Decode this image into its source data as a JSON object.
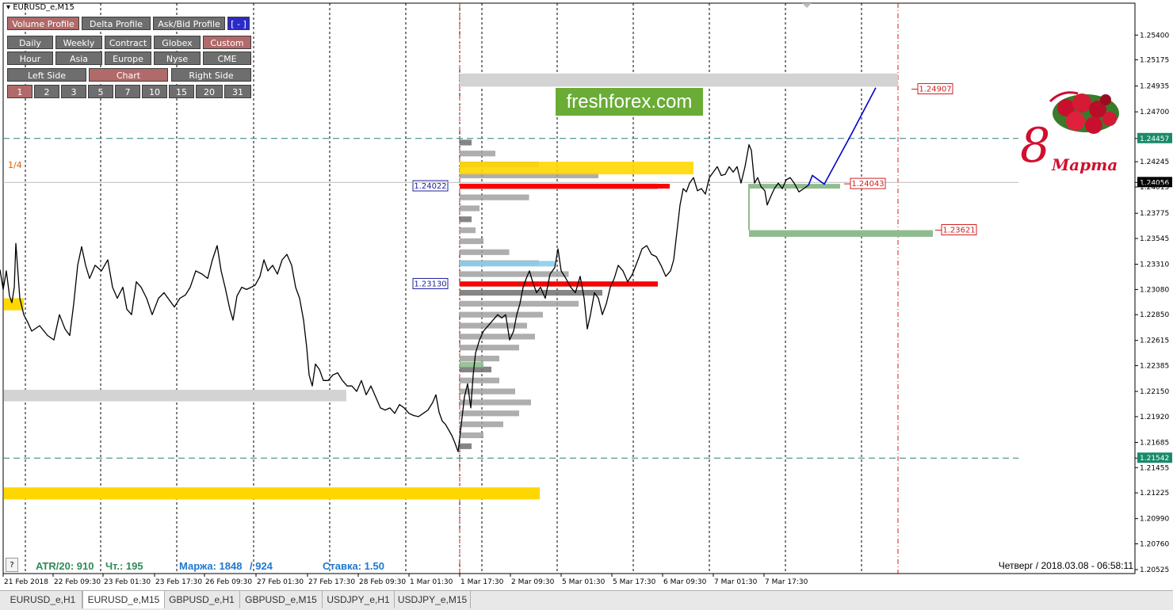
{
  "window": {
    "title": "EURUSD_e,M15"
  },
  "toolbar": {
    "row1": [
      {
        "label": "Volume Profile",
        "active": true
      },
      {
        "label": "Delta Profile",
        "active": false
      },
      {
        "label": "Ask/Bid Profile",
        "active": false
      },
      {
        "label": "[ - ]",
        "active": false
      }
    ],
    "row2": [
      {
        "label": "Daily",
        "active": false
      },
      {
        "label": "Weekly",
        "active": false
      },
      {
        "label": "Contract",
        "active": false
      },
      {
        "label": "Globex",
        "active": false
      },
      {
        "label": "Custom",
        "active": true
      }
    ],
    "row3": [
      {
        "label": "Hour",
        "active": false
      },
      {
        "label": "Asia",
        "active": false
      },
      {
        "label": "Europe",
        "active": false
      },
      {
        "label": "Nyse",
        "active": false
      },
      {
        "label": "CME",
        "active": false
      }
    ],
    "row4": [
      {
        "label": "Left Side",
        "active": false
      },
      {
        "label": "Chart",
        "active": true
      },
      {
        "label": "Right Side",
        "active": false
      }
    ],
    "row5": [
      {
        "label": "1",
        "active": true
      },
      {
        "label": "2",
        "active": false
      },
      {
        "label": "3",
        "active": false
      },
      {
        "label": "5",
        "active": false
      },
      {
        "label": "7",
        "active": false
      },
      {
        "label": "10",
        "active": false
      },
      {
        "label": "15",
        "active": false
      },
      {
        "label": "20",
        "active": false
      },
      {
        "label": "31",
        "active": false
      }
    ]
  },
  "watermark": {
    "text": "freshforex.com",
    "greeting_number": "8",
    "greeting_word": "Марта"
  },
  "fraction_label": "1/4",
  "info": {
    "atr": "ATR/20: 910",
    "ticks": "Чт.: 195",
    "margin": "Маржа: 1848",
    "margin2": "/ 924",
    "rate": "Ставка: 1.50",
    "clock": "Четверг  /  2018.03.08  -  06:58:11",
    "help": "?"
  },
  "tabs": [
    {
      "label": "EURUSD_e,H1",
      "active": false
    },
    {
      "label": "EURUSD_e,M15",
      "active": true
    },
    {
      "label": "GBPUSD_e,H1",
      "active": false
    },
    {
      "label": "GBPUSD_e,M15",
      "active": false
    },
    {
      "label": "USDJPY_e,H1",
      "active": false
    },
    {
      "label": "USDJPY_e,M15",
      "active": false
    }
  ],
  "colors": {
    "price_line": "#000000",
    "projection": "#0000cc",
    "yellow_zone": "#ffd700",
    "grey_zone": "#d3d3d3",
    "green_zone": "#8fbc8f",
    "poc_red": "#ff0000",
    "profile_grey": "#a0a0a0",
    "profile_dark": "#707070",
    "teal_line": "#2f7f7f",
    "current_price_bg": "#000000",
    "teal_label_bg": "#1a8a6a",
    "logo_green": "#6aac36"
  },
  "chart_data": {
    "type": "line",
    "symbol": "EURUSD_e",
    "timeframe": "M15",
    "ylim": [
      1.20525,
      1.25525
    ],
    "y_ticks": [
      "1.25400",
      "1.25175",
      "1.24935",
      "1.24700",
      "1.24457",
      "1.24245",
      "1.24056",
      "1.24015",
      "1.23775",
      "1.23545",
      "1.23310",
      "1.23080",
      "1.22850",
      "1.22615",
      "1.22385",
      "1.22150",
      "1.21920",
      "1.21685",
      "1.21542",
      "1.21455",
      "1.21225",
      "1.20990",
      "1.20760",
      "1.20525"
    ],
    "x_labels": [
      "21 Feb 2018",
      "22 Feb 09:30",
      "23 Feb 01:30",
      "23 Feb 17:30",
      "26 Feb 09:30",
      "27 Feb 01:30",
      "27 Feb 17:30",
      "28 Feb 09:30",
      "1 Mar 01:30",
      "1 Mar 17:30",
      "2 Mar 09:30",
      "5 Mar 01:30",
      "5 Mar 17:30",
      "6 Mar 09:30",
      "7 Mar 01:30",
      "7 Mar 17:30"
    ],
    "price_series": [
      [
        0,
        1.2326
      ],
      [
        4,
        1.2308
      ],
      [
        8,
        1.2325
      ],
      [
        12,
        1.2302
      ],
      [
        15,
        1.2296
      ],
      [
        18,
        1.231
      ],
      [
        20,
        1.235
      ],
      [
        22,
        1.233
      ],
      [
        25,
        1.23
      ],
      [
        30,
        1.2285
      ],
      [
        35,
        1.2278
      ],
      [
        40,
        1.227
      ],
      [
        50,
        1.2275
      ],
      [
        60,
        1.2266
      ],
      [
        68,
        1.2262
      ],
      [
        75,
        1.2285
      ],
      [
        82,
        1.2272
      ],
      [
        88,
        1.2266
      ],
      [
        93,
        1.2295
      ],
      [
        98,
        1.233
      ],
      [
        103,
        1.2347
      ],
      [
        108,
        1.233
      ],
      [
        113,
        1.2318
      ],
      [
        120,
        1.233
      ],
      [
        128,
        1.2325
      ],
      [
        136,
        1.2335
      ],
      [
        142,
        1.231
      ],
      [
        148,
        1.23
      ],
      [
        155,
        1.231
      ],
      [
        160,
        1.229
      ],
      [
        166,
        1.2285
      ],
      [
        172,
        1.2315
      ],
      [
        178,
        1.231
      ],
      [
        185,
        1.23
      ],
      [
        192,
        1.2285
      ],
      [
        200,
        1.23
      ],
      [
        207,
        1.2305
      ],
      [
        214,
        1.2298
      ],
      [
        220,
        1.2292
      ],
      [
        227,
        1.23
      ],
      [
        234,
        1.2303
      ],
      [
        240,
        1.231
      ],
      [
        247,
        1.2325
      ],
      [
        255,
        1.2322
      ],
      [
        262,
        1.2318
      ],
      [
        268,
        1.2335
      ],
      [
        274,
        1.2348
      ],
      [
        279,
        1.2325
      ],
      [
        284,
        1.231
      ],
      [
        290,
        1.229
      ],
      [
        294,
        1.228
      ],
      [
        299,
        1.2302
      ],
      [
        305,
        1.231
      ],
      [
        311,
        1.2308
      ],
      [
        317,
        1.231
      ],
      [
        322,
        1.2312
      ],
      [
        328,
        1.232
      ],
      [
        333,
        1.2335
      ],
      [
        338,
        1.2325
      ],
      [
        344,
        1.233
      ],
      [
        350,
        1.2322
      ],
      [
        356,
        1.2335
      ],
      [
        362,
        1.234
      ],
      [
        368,
        1.233
      ],
      [
        373,
        1.231
      ],
      [
        378,
        1.23
      ],
      [
        383,
        1.228
      ],
      [
        387,
        1.2255
      ],
      [
        390,
        1.223
      ],
      [
        394,
        1.222
      ],
      [
        398,
        1.224
      ],
      [
        403,
        1.2235
      ],
      [
        408,
        1.2225
      ],
      [
        414,
        1.2225
      ],
      [
        420,
        1.223
      ],
      [
        426,
        1.2232
      ],
      [
        432,
        1.2225
      ],
      [
        438,
        1.222
      ],
      [
        444,
        1.222
      ],
      [
        450,
        1.2215
      ],
      [
        456,
        1.2225
      ],
      [
        462,
        1.2212
      ],
      [
        468,
        1.222
      ],
      [
        474,
        1.221
      ],
      [
        480,
        1.22
      ],
      [
        486,
        1.2198
      ],
      [
        492,
        1.22
      ],
      [
        498,
        1.2195
      ],
      [
        504,
        1.2203
      ],
      [
        510,
        1.22
      ],
      [
        516,
        1.2195
      ],
      [
        522,
        1.2193
      ],
      [
        528,
        1.2192
      ],
      [
        534,
        1.2195
      ],
      [
        540,
        1.2198
      ],
      [
        546,
        1.2205
      ],
      [
        550,
        1.2212
      ],
      [
        554,
        1.2196
      ],
      [
        558,
        1.2188
      ],
      [
        562,
        1.2185
      ],
      [
        566,
        1.218
      ],
      [
        570,
        1.2175
      ],
      [
        574,
        1.2168
      ],
      [
        578,
        1.216
      ],
      [
        582,
        1.2185
      ],
      [
        586,
        1.221
      ],
      [
        590,
        1.2222
      ],
      [
        594,
        1.22
      ],
      [
        597,
        1.223
      ],
      [
        600,
        1.225
      ],
      [
        605,
        1.2262
      ],
      [
        610,
        1.227
      ],
      [
        616,
        1.2275
      ],
      [
        622,
        1.228
      ],
      [
        628,
        1.2285
      ],
      [
        633,
        1.2282
      ],
      [
        638,
        1.2285
      ],
      [
        643,
        1.2262
      ],
      [
        648,
        1.227
      ],
      [
        652,
        1.2285
      ],
      [
        656,
        1.2295
      ],
      [
        660,
        1.231
      ],
      [
        664,
        1.2318
      ],
      [
        668,
        1.2325
      ],
      [
        672,
        1.2315
      ],
      [
        677,
        1.2305
      ],
      [
        682,
        1.231
      ],
      [
        688,
        1.23
      ],
      [
        694,
        1.2322
      ],
      [
        700,
        1.2328
      ],
      [
        704,
        1.2345
      ],
      [
        708,
        1.2325
      ],
      [
        714,
        1.2318
      ],
      [
        720,
        1.231
      ],
      [
        726,
        1.2305
      ],
      [
        732,
        1.232
      ],
      [
        737,
        1.23
      ],
      [
        741,
        1.2272
      ],
      [
        745,
        1.2285
      ],
      [
        750,
        1.2305
      ],
      [
        755,
        1.23
      ],
      [
        760,
        1.2285
      ],
      [
        765,
        1.2295
      ],
      [
        770,
        1.231
      ],
      [
        775,
        1.2318
      ],
      [
        780,
        1.233
      ],
      [
        786,
        1.2325
      ],
      [
        792,
        1.2315
      ],
      [
        798,
        1.2322
      ],
      [
        805,
        1.2335
      ],
      [
        810,
        1.2345
      ],
      [
        816,
        1.2348
      ],
      [
        822,
        1.234
      ],
      [
        828,
        1.2338
      ],
      [
        834,
        1.233
      ],
      [
        840,
        1.232
      ],
      [
        846,
        1.2325
      ],
      [
        850,
        1.2335
      ],
      [
        854,
        1.236
      ],
      [
        858,
        1.2385
      ],
      [
        862,
        1.24
      ],
      [
        866,
        1.2397
      ],
      [
        870,
        1.2405
      ],
      [
        875,
        1.241
      ],
      [
        880,
        1.2398
      ],
      [
        885,
        1.24
      ],
      [
        890,
        1.2395
      ],
      [
        895,
        1.241
      ],
      [
        900,
        1.2415
      ],
      [
        905,
        1.242
      ],
      [
        910,
        1.2412
      ],
      [
        915,
        1.2413
      ],
      [
        920,
        1.242
      ],
      [
        925,
        1.2415
      ],
      [
        930,
        1.242
      ],
      [
        935,
        1.2405
      ],
      [
        940,
        1.242
      ],
      [
        945,
        1.244
      ],
      [
        948,
        1.2435
      ],
      [
        952,
        1.2405
      ],
      [
        956,
        1.241
      ],
      [
        960,
        1.2402
      ],
      [
        965,
        1.2398
      ],
      [
        968,
        1.2385
      ],
      [
        972,
        1.2392
      ],
      [
        977,
        1.24
      ],
      [
        982,
        1.2405
      ],
      [
        987,
        1.24
      ],
      [
        992,
        1.2408
      ],
      [
        997,
        1.241
      ],
      [
        1002,
        1.2405
      ],
      [
        1008,
        1.2397
      ],
      [
        1014,
        1.24
      ],
      [
        1020,
        1.2403
      ]
    ],
    "projection": [
      [
        1020,
        1.2403
      ],
      [
        1025,
        1.2412
      ],
      [
        1040,
        1.2404
      ],
      [
        1073,
        1.2448
      ],
      [
        1105,
        1.2492
      ]
    ],
    "horizontal_levels": [
      {
        "price": 1.24457,
        "style": "dashed",
        "label": "1.24457"
      },
      {
        "price": 1.21542,
        "style": "dashed",
        "label": "1.21542"
      },
      {
        "price": 1.24056,
        "style": "solid-thin",
        "label": "1.24056"
      }
    ],
    "level_labels": [
      {
        "price": 1.24907,
        "label": "1.24907"
      },
      {
        "price": 1.24043,
        "label": "1.24043"
      },
      {
        "price": 1.23621,
        "label": "1.23621"
      }
    ],
    "poc_labels": [
      {
        "price": 1.24022,
        "label": "1.24022"
      },
      {
        "price": 1.2313,
        "label": "1.23130"
      }
    ],
    "zones": [
      {
        "kind": "grey",
        "x0": 580,
        "x1": 1133,
        "y0": 1.2505,
        "y1": 1.2493
      },
      {
        "kind": "yellow",
        "x0": 5,
        "x1": 30,
        "y0": 1.23,
        "y1": 1.2289
      },
      {
        "kind": "grey",
        "x0": 5,
        "x1": 437,
        "y0": 1.22165,
        "y1": 1.2206
      },
      {
        "kind": "yellow",
        "x0": 5,
        "x1": 681,
        "y0": 1.21275,
        "y1": 1.21165
      },
      {
        "kind": "green",
        "x0": 945,
        "x1": 1060,
        "y0": 1.24043,
        "y1": 1.24
      },
      {
        "kind": "green",
        "x0": 945,
        "x1": 1177,
        "y0": 1.23621,
        "y1": 1.2356
      }
    ],
    "volume_profile": [
      [
        1.2165,
        0.06
      ],
      [
        1.2175,
        0.12
      ],
      [
        1.2185,
        0.22
      ],
      [
        1.2195,
        0.3
      ],
      [
        1.2205,
        0.36
      ],
      [
        1.2215,
        0.28
      ],
      [
        1.2225,
        0.2
      ],
      [
        1.2235,
        0.16
      ],
      [
        1.2245,
        0.2
      ],
      [
        1.2255,
        0.3
      ],
      [
        1.2265,
        0.38
      ],
      [
        1.2275,
        0.34
      ],
      [
        1.2285,
        0.42
      ],
      [
        1.2295,
        0.6
      ],
      [
        1.2305,
        0.72
      ],
      [
        1.2313,
        1.0
      ],
      [
        1.2322,
        0.55
      ],
      [
        1.2332,
        0.4
      ],
      [
        1.2342,
        0.25
      ],
      [
        1.2352,
        0.12
      ],
      [
        1.2362,
        0.08
      ],
      [
        1.2372,
        0.06
      ],
      [
        1.2382,
        0.1
      ],
      [
        1.2392,
        0.35
      ],
      [
        1.2402,
        1.0
      ],
      [
        1.2412,
        0.7
      ],
      [
        1.2422,
        0.4
      ],
      [
        1.2432,
        0.18
      ],
      [
        1.2442,
        0.06
      ]
    ],
    "profile_zones": [
      {
        "kind": "yellow",
        "y0": 1.24245,
        "y1": 1.2413
      },
      {
        "kind": "lightblue",
        "y0": 1.2334,
        "y1": 1.2329
      },
      {
        "kind": "green",
        "y0": 1.2242,
        "y1": 1.2237
      }
    ]
  }
}
